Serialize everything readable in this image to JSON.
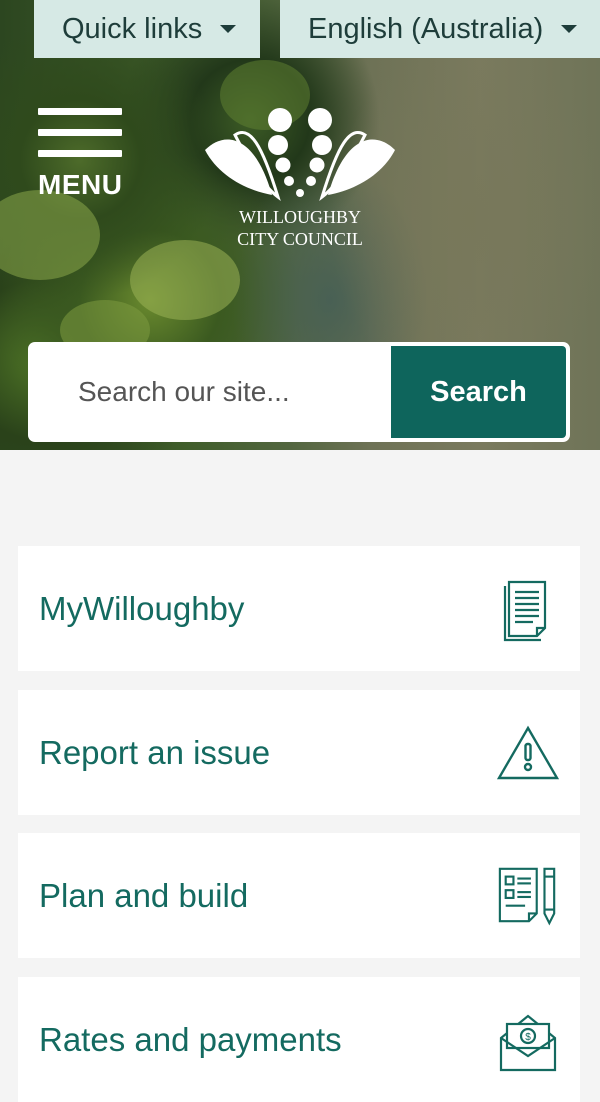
{
  "topbar": {
    "quick_links": "Quick links",
    "language": "English (Australia)"
  },
  "header": {
    "menu_label": "MENU",
    "logo_line1": "WILLOUGHBY",
    "logo_line2": "CITY COUNCIL"
  },
  "search": {
    "placeholder": "Search our site...",
    "button_label": "Search"
  },
  "cards": [
    {
      "label": "MyWilloughby",
      "icon": "document-icon"
    },
    {
      "label": "Report an issue",
      "icon": "warning-icon"
    },
    {
      "label": "Plan and build",
      "icon": "plan-form-icon"
    },
    {
      "label": "Rates and payments",
      "icon": "money-envelope-icon"
    }
  ],
  "colors": {
    "accent": "#0e655c",
    "card_text": "#146a60",
    "topbar_bg": "#d6e9e5",
    "page_bg": "#f4f4f4"
  }
}
